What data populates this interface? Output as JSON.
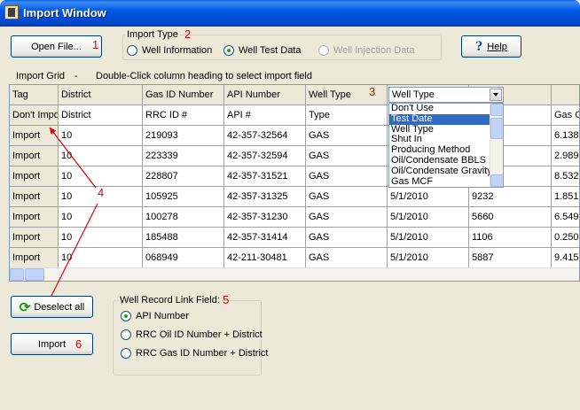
{
  "window": {
    "title": "Import Window"
  },
  "toolbar": {
    "open_file_label": "Open File...",
    "help_label": "Help",
    "callout_1": "1",
    "callout_2": "2",
    "callout_3": "3",
    "callout_4": "4",
    "callout_5": "5",
    "callout_6": "6"
  },
  "import_type": {
    "title": "Import Type",
    "options": [
      {
        "label": "Well Information",
        "checked": false,
        "enabled": true
      },
      {
        "label": "Well Test Data",
        "checked": true,
        "enabled": true
      },
      {
        "label": "Well Injection Data",
        "checked": false,
        "enabled": false
      }
    ]
  },
  "grid_caption": {
    "label": "Import Grid",
    "separator": "-",
    "hint": "Double-Click column heading to select import field"
  },
  "grid": {
    "headers": [
      "Tag",
      "District",
      "Gas ID Number",
      "API Number",
      "Well Type",
      "",
      "",
      ""
    ],
    "mapping_row": [
      "Don't Import",
      "District",
      "RRC ID #",
      "API #",
      "Type",
      "",
      "",
      "Gas Ga"
    ],
    "rows": [
      [
        "Import",
        "10",
        "219093",
        "42-357-32564",
        "GAS",
        "",
        "",
        "6.138"
      ],
      [
        "Import",
        "10",
        "223339",
        "42-357-32594",
        "GAS",
        "",
        "",
        "2.989"
      ],
      [
        "Import",
        "10",
        "228807",
        "42-357-31521",
        "GAS",
        "",
        "",
        "8.532"
      ],
      [
        "Import",
        "10",
        "105925",
        "42-357-31325",
        "GAS",
        "5/1/2010",
        "9232",
        "1.851"
      ],
      [
        "Import",
        "10",
        "100278",
        "42-357-31230",
        "GAS",
        "5/1/2010",
        "5660",
        "6.549"
      ],
      [
        "Import",
        "10",
        "185488",
        "42-357-31414",
        "GAS",
        "5/1/2010",
        "1106",
        "0.250"
      ],
      [
        "Import",
        "10",
        "068949",
        "42-211-30481",
        "GAS",
        "5/1/2010",
        "5887",
        "9.415"
      ]
    ]
  },
  "dropdown": {
    "selected": "Well Type",
    "items": [
      "Don't Use",
      "Test Date",
      "Well Type",
      "Shut In",
      "Producing Method",
      "Oil/Condensate BBLS",
      "Oil/Condensate Gravity",
      "Gas MCF"
    ],
    "highlighted_index": 1
  },
  "actions": {
    "deselect_all_label": "Deselect all",
    "import_label": "Import"
  },
  "link_field": {
    "title": "Well Record Link Field:",
    "options": [
      {
        "label": "API Number",
        "checked": true
      },
      {
        "label": "RRC Oil ID Number + District",
        "checked": false
      },
      {
        "label": "RRC Gas ID Number + District",
        "checked": false
      }
    ]
  },
  "colors": {
    "titlebar": "#0054e3",
    "callout": "#e00000",
    "selection": "#316ac5"
  },
  "icons": [
    "app-icon",
    "help-icon",
    "refresh-icon",
    "dropdown-arrow-icon"
  ]
}
